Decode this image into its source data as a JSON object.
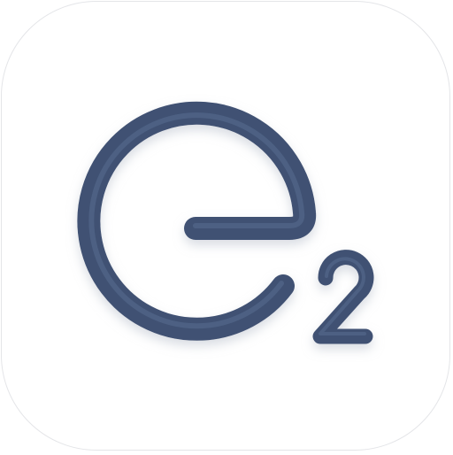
{
  "app_icon": {
    "logo_text": "e2",
    "tile_color": "#ffffff",
    "tile_border_color": "#e4e5e8",
    "glyph_color": "#3f5173",
    "glyph_highlight_color": "#5a6d90",
    "glyph_shadow_color": "#b9c0cc"
  }
}
